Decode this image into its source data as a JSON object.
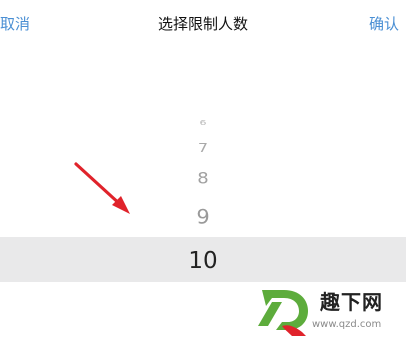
{
  "header": {
    "cancel_label": "取消",
    "title": "选择限制人数",
    "confirm_label": "确认"
  },
  "picker": {
    "items": [
      "6",
      "7",
      "8",
      "9",
      "10"
    ],
    "selected": "10"
  },
  "watermark": {
    "name": "趣下网",
    "url": "www.qzd.com"
  },
  "colors": {
    "accent": "#4a8fd4",
    "highlight": "#e9e9ea",
    "arrow": "#e0232b",
    "logo_green": "#5dac3c"
  }
}
